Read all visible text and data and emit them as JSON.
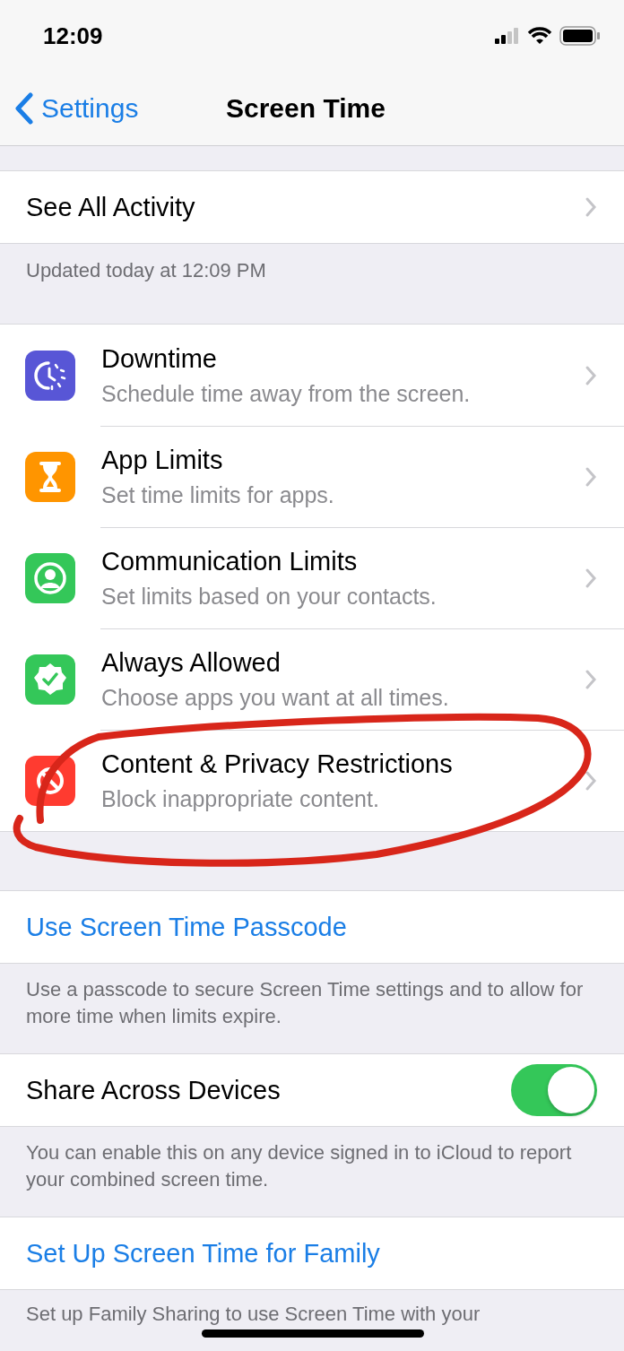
{
  "status_bar": {
    "time": "12:09"
  },
  "nav": {
    "back": "Settings",
    "title": "Screen Time"
  },
  "activity": {
    "label": "See All Activity",
    "footer": "Updated today at 12:09 PM"
  },
  "items": [
    {
      "kind": "downtime",
      "color": "#5856d6",
      "title": "Downtime",
      "subtitle": "Schedule time away from the screen."
    },
    {
      "kind": "app-limits",
      "color": "#ff9500",
      "title": "App Limits",
      "subtitle": "Set time limits for apps."
    },
    {
      "kind": "communication",
      "color": "#34c759",
      "title": "Communication Limits",
      "subtitle": "Set limits based on your contacts."
    },
    {
      "kind": "always-allowed",
      "color": "#34c759",
      "title": "Always Allowed",
      "subtitle": "Choose apps you want at all times."
    },
    {
      "kind": "restrictions",
      "color": "#ff3b30",
      "title": "Content & Privacy Restrictions",
      "subtitle": "Block inappropriate content."
    }
  ],
  "passcode": {
    "label": "Use Screen Time Passcode",
    "footer": "Use a passcode to secure Screen Time settings and to allow for more time when limits expire."
  },
  "share": {
    "label": "Share Across Devices",
    "on": true,
    "footer": "You can enable this on any device signed in to iCloud to report your combined screen time."
  },
  "family": {
    "label": "Set Up Screen Time for Family",
    "footer": "Set up Family Sharing to use Screen Time with your"
  }
}
